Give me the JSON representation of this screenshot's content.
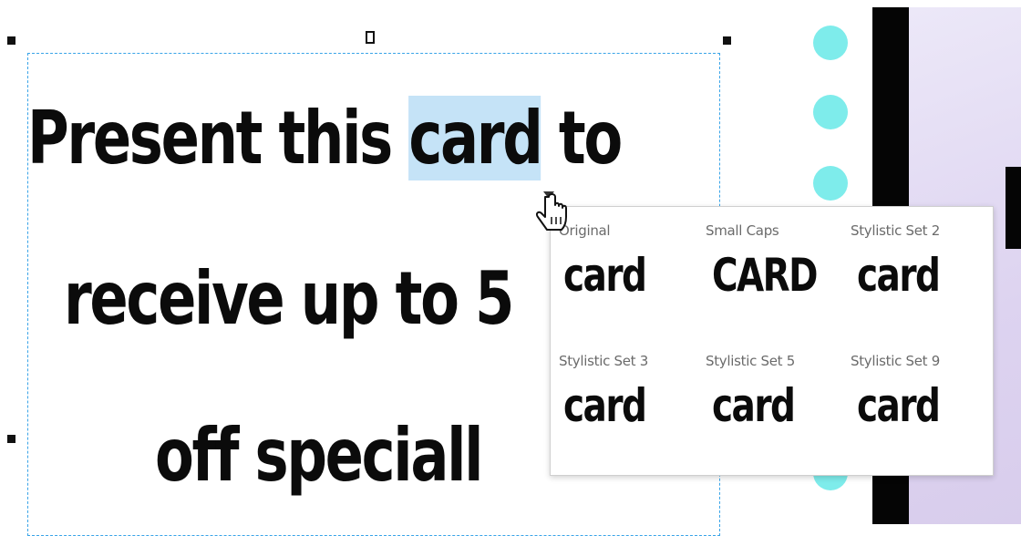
{
  "document": {
    "lines": [
      "Present this",
      "card",
      "to",
      "receive up to 5",
      "off speciall"
    ]
  },
  "glyph_popup": {
    "alternates": [
      {
        "label": "Original",
        "preview": "card"
      },
      {
        "label": "Small Caps",
        "preview": "CARD"
      },
      {
        "label": "Stylistic Set 2",
        "preview": "card"
      },
      {
        "label": "Stylistic Set 3",
        "preview": "card"
      },
      {
        "label": "Stylistic Set 5",
        "preview": "card"
      },
      {
        "label": "Stylistic Set 9",
        "preview": "card"
      }
    ]
  },
  "colors": {
    "selection_border": "#39a4e8",
    "text_highlight": "#c5e3f7",
    "dots": "#7eeceb",
    "panel": "#ddd3f0"
  },
  "icons": {
    "cursor": "hand-pointer-icon"
  }
}
